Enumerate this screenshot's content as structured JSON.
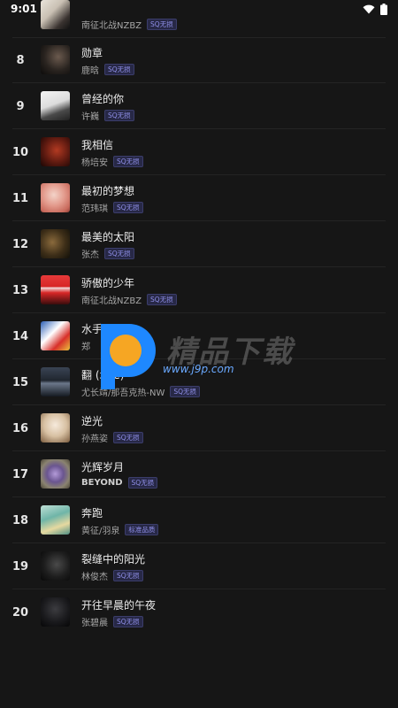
{
  "status_bar": {
    "time": "9:01",
    "icons": [
      "wifi-icon",
      "battery-icon"
    ]
  },
  "badges": {
    "sq": "SQ无损",
    "standard": "标准品质"
  },
  "rows": [
    {
      "rank": "",
      "title": "",
      "artist": "南征北战NZBZ",
      "badge": "SQ无损"
    },
    {
      "rank": "8",
      "title": "勋章",
      "artist": "鹿晗",
      "badge": "SQ无损"
    },
    {
      "rank": "9",
      "title": "曾经的你",
      "artist": "许巍",
      "badge": "SQ无损"
    },
    {
      "rank": "10",
      "title": "我相信",
      "artist": "杨培安",
      "badge": "SQ无损"
    },
    {
      "rank": "11",
      "title": "最初的梦想",
      "artist": "范玮琪",
      "badge": "SQ无损"
    },
    {
      "rank": "12",
      "title": "最美的太阳",
      "artist": "张杰",
      "badge": "SQ无损"
    },
    {
      "rank": "13",
      "title": "骄傲的少年",
      "artist": "南征北战NZBZ",
      "badge": "SQ无损"
    },
    {
      "rank": "14",
      "title": "水手",
      "artist": "郑",
      "badge": ""
    },
    {
      "rank": "15",
      "title": "翻 (北 e)",
      "artist": "尤长靖/那吾克热-NW",
      "badge": "SQ无损"
    },
    {
      "rank": "16",
      "title": "逆光",
      "artist": "孙燕姿",
      "badge": "SQ无损"
    },
    {
      "rank": "17",
      "title": "光辉岁月",
      "artist": "BEYOND",
      "badge": "SQ无损"
    },
    {
      "rank": "18",
      "title": "奔跑",
      "artist": "黄征/羽泉",
      "badge": "标准品质"
    },
    {
      "rank": "19",
      "title": "裂缝中的阳光",
      "artist": "林俊杰",
      "badge": "SQ无损"
    },
    {
      "rank": "20",
      "title": "开往早晨的午夜",
      "artist": "张碧晨",
      "badge": "SQ无损"
    }
  ],
  "watermark": {
    "brand": "精品下载",
    "url": "www.j9p.com"
  },
  "colors": {
    "background": "#161616",
    "badge_text": "#8f8fe8",
    "badge_bg": "#272846",
    "watermark_orange": "#f6a623",
    "watermark_blue": "#1e88ff"
  }
}
